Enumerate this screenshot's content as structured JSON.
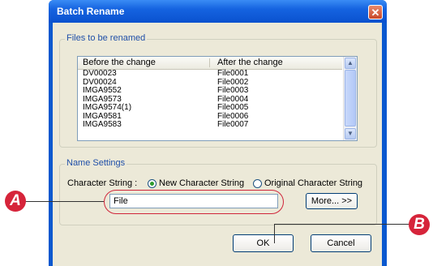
{
  "dialog": {
    "title": "Batch Rename",
    "close_glyph": "✕"
  },
  "files_group": {
    "label": "Files to be renamed",
    "columns": [
      "Before the change",
      "After the change"
    ],
    "rows": [
      {
        "before": "DV00023",
        "after": "File0001"
      },
      {
        "before": "DV00024",
        "after": "File0002"
      },
      {
        "before": "IMGA9552",
        "after": "File0003"
      },
      {
        "before": "IMGA9573",
        "after": "File0004"
      },
      {
        "before": "IMGA9574(1)",
        "after": "File0005"
      },
      {
        "before": "IMGA9581",
        "after": "File0006"
      },
      {
        "before": "IMGA9583",
        "after": "File0007"
      }
    ],
    "scroll_up": "▲",
    "scroll_down": "▼"
  },
  "name_settings": {
    "label": "Name Settings",
    "char_string_label": "Character String :",
    "option_new": "New Character String",
    "option_original": "Original Character String",
    "selected": "new",
    "input_value": "File",
    "more_button": "More... >>"
  },
  "buttons": {
    "ok": "OK",
    "cancel": "Cancel"
  },
  "callouts": {
    "a": "A",
    "b": "B"
  }
}
